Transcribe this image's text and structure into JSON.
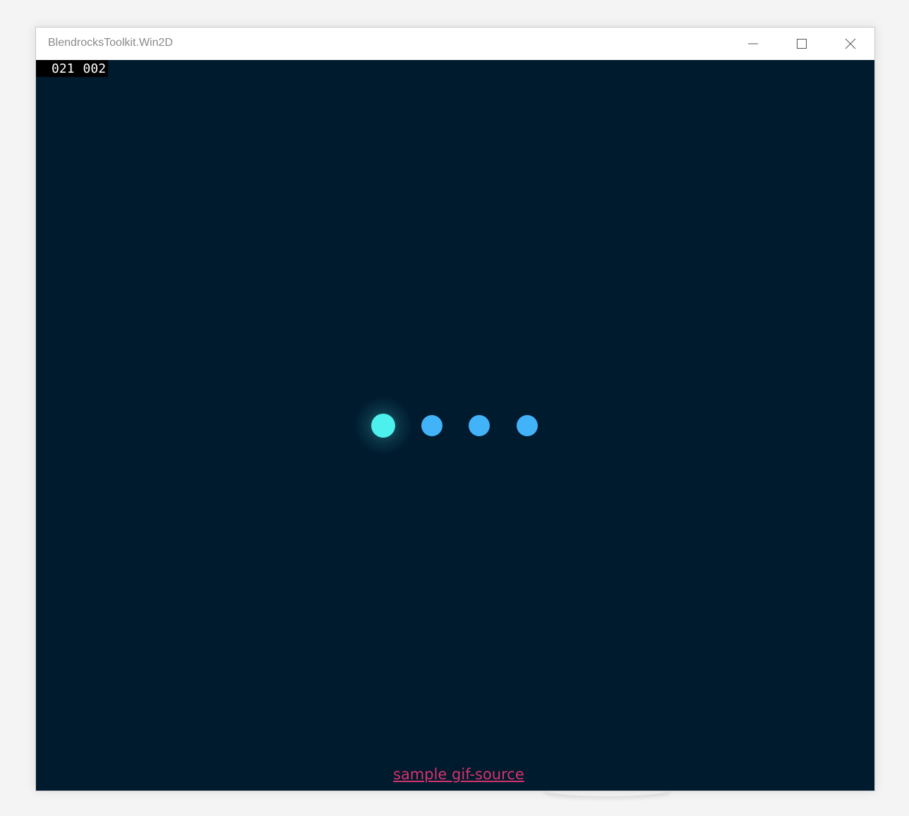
{
  "window": {
    "title": "BlendrocksToolkit.Win2D"
  },
  "caption_buttons": {
    "minimize_icon": "minimize-icon",
    "maximize_icon": "maximize-icon",
    "close_icon": "close-icon"
  },
  "counters": {
    "first": "021",
    "second": "002"
  },
  "loader": {
    "dot_count": 4,
    "active_index": 0,
    "active_color": "#4cf0ec",
    "inactive_color": "#42b2f9"
  },
  "footer": {
    "link_text": "sample gif-source"
  },
  "colors": {
    "canvas_background": "#001a2e",
    "link_color": "#d6336c"
  }
}
